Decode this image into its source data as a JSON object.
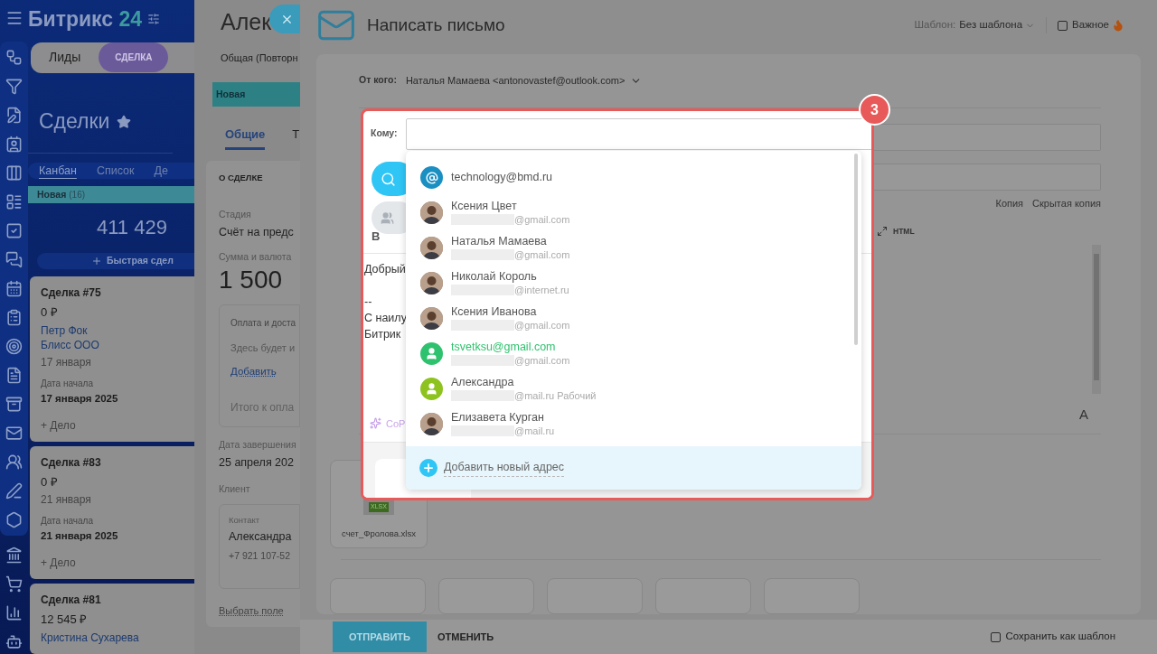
{
  "app": {
    "logo_name": "Битрикс",
    "logo_number": "24"
  },
  "crm_tabs": [
    {
      "label": "Лиды",
      "selected": false
    },
    {
      "label": "СДЕЛКА",
      "selected": true
    }
  ],
  "page_title": "Сделки",
  "view_tabs": [
    {
      "label": "Канбан",
      "selected": true
    },
    {
      "label": "Список",
      "selected": false
    },
    {
      "label": "Де",
      "selected": false
    }
  ],
  "column": {
    "title": "Новая",
    "count": "(16)",
    "total": "411 429",
    "quick_add": "Быстрая сдел"
  },
  "deals": [
    {
      "title": "Сделка #75",
      "amount": "0 ₽",
      "contact": "Петр Фок",
      "company": "Блисс ООО",
      "date": "17 января",
      "start_label": "Дата начала",
      "start_date": "17 января 2025",
      "action": "+ Дело"
    },
    {
      "title": "Сделка #83",
      "amount": "0 ₽",
      "date": "21 января",
      "start_label": "Дата начала",
      "start_date": "21 января 2025",
      "action": "+ Дело"
    },
    {
      "title": "Сделка #81",
      "amount": "12 545 ₽",
      "contact": "Кристина Сухарева"
    }
  ],
  "deal_panel": {
    "title": "Алек",
    "subtitle": "Общая (Повторн",
    "stage": "Новая",
    "tabs": [
      {
        "label": "Общие",
        "selected": true
      },
      {
        "label": "Т",
        "selected": false
      }
    ],
    "section": "О СДЕЛКЕ",
    "stage_label": "Стадия",
    "stage_value": "Счёт на предс",
    "sum_label": "Сумма и валюта",
    "sum_value": "1 500",
    "products": {
      "title": "Оплата и доста",
      "hint": "Здесь будет и",
      "add": "Добавить",
      "total": "Итого к опла"
    },
    "close_label": "Дата завершения",
    "close_date": "25 апреля 202",
    "client_label": "Клиент",
    "contact": {
      "label": "Контакт",
      "name": "Александра",
      "phone": "+7 921 107-52"
    },
    "choose_field": "Выбрать поле"
  },
  "email": {
    "title": "Написать письмо",
    "template_label": "Шаблон:",
    "template_value": "Без шаблона",
    "important": {
      "label": "Важное",
      "checked": false
    },
    "from_label": "От кого:",
    "from_value": "Наталья Мамаева <antonovastef@outlook.com>",
    "to_label": "Кому:",
    "copy_links": [
      "Копия",
      "Скрытая копия"
    ],
    "toolbar_bold": "В",
    "toolbar_html": "HTML",
    "body_lines": [
      "Добрый",
      "--",
      "С наилу",
      "Битрик"
    ],
    "copilot": "CoP",
    "font_button": "A",
    "attachment": {
      "name": "счет_Фролова.xlsx",
      "type": "XLSX"
    },
    "suggestions": [
      {
        "kind": "address",
        "name": "technology@bmd.ru",
        "color": "#1a8fc2"
      },
      {
        "kind": "photo",
        "name": "Ксения Цвет",
        "email": "@gmail.com"
      },
      {
        "kind": "photo",
        "name": "Наталья Мамаева",
        "email": "@gmail.com"
      },
      {
        "kind": "photo",
        "name": "Николай Король",
        "email": "@internet.ru"
      },
      {
        "kind": "photo",
        "name": "Ксения Иванова",
        "email": "@gmail.com"
      },
      {
        "kind": "found",
        "name": "tsvetksu@gmail.com",
        "email": "@gmail.com",
        "color": "#2fc26e"
      },
      {
        "kind": "user",
        "name": "Александра",
        "email": "@mail.ru Рабочий",
        "color": "#8dc21f"
      },
      {
        "kind": "photo",
        "name": "Елизавета Курган",
        "email": "@mail.ru"
      }
    ],
    "add_address": "Добавить новый адрес",
    "send": "ОТПРАВИТЬ",
    "cancel": "ОТМЕНИТЬ",
    "save_template": {
      "label": "Сохранить как шаблон",
      "checked": false
    },
    "step_badge": "3"
  }
}
